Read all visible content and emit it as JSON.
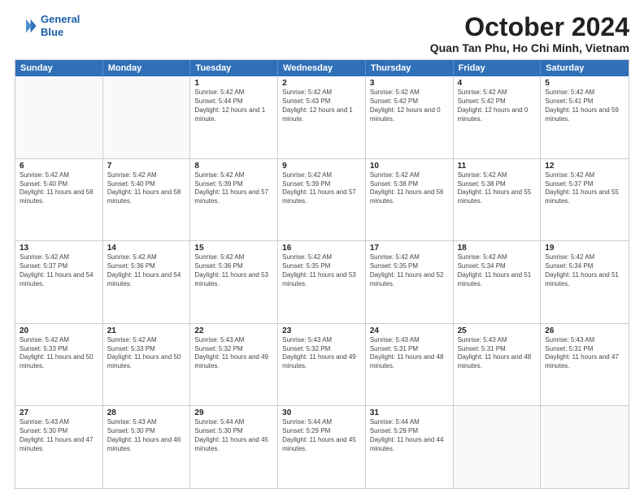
{
  "header": {
    "logo_line1": "General",
    "logo_line2": "Blue",
    "month_title": "October 2024",
    "subtitle": "Quan Tan Phu, Ho Chi Minh, Vietnam"
  },
  "days_of_week": [
    "Sunday",
    "Monday",
    "Tuesday",
    "Wednesday",
    "Thursday",
    "Friday",
    "Saturday"
  ],
  "weeks": [
    [
      {
        "day": "",
        "empty": true
      },
      {
        "day": "",
        "empty": true
      },
      {
        "day": "1",
        "sunrise": "5:42 AM",
        "sunset": "5:44 PM",
        "daylight": "12 hours and 1 minute."
      },
      {
        "day": "2",
        "sunrise": "5:42 AM",
        "sunset": "5:43 PM",
        "daylight": "12 hours and 1 minute."
      },
      {
        "day": "3",
        "sunrise": "5:42 AM",
        "sunset": "5:42 PM",
        "daylight": "12 hours and 0 minutes."
      },
      {
        "day": "4",
        "sunrise": "5:42 AM",
        "sunset": "5:42 PM",
        "daylight": "12 hours and 0 minutes."
      },
      {
        "day": "5",
        "sunrise": "5:42 AM",
        "sunset": "5:41 PM",
        "daylight": "11 hours and 59 minutes."
      }
    ],
    [
      {
        "day": "6",
        "sunrise": "5:42 AM",
        "sunset": "5:40 PM",
        "daylight": "11 hours and 58 minutes."
      },
      {
        "day": "7",
        "sunrise": "5:42 AM",
        "sunset": "5:40 PM",
        "daylight": "11 hours and 58 minutes."
      },
      {
        "day": "8",
        "sunrise": "5:42 AM",
        "sunset": "5:39 PM",
        "daylight": "11 hours and 57 minutes."
      },
      {
        "day": "9",
        "sunrise": "5:42 AM",
        "sunset": "5:39 PM",
        "daylight": "11 hours and 57 minutes."
      },
      {
        "day": "10",
        "sunrise": "5:42 AM",
        "sunset": "5:38 PM",
        "daylight": "11 hours and 56 minutes."
      },
      {
        "day": "11",
        "sunrise": "5:42 AM",
        "sunset": "5:38 PM",
        "daylight": "11 hours and 55 minutes."
      },
      {
        "day": "12",
        "sunrise": "5:42 AM",
        "sunset": "5:37 PM",
        "daylight": "11 hours and 55 minutes."
      }
    ],
    [
      {
        "day": "13",
        "sunrise": "5:42 AM",
        "sunset": "5:37 PM",
        "daylight": "11 hours and 54 minutes."
      },
      {
        "day": "14",
        "sunrise": "5:42 AM",
        "sunset": "5:36 PM",
        "daylight": "11 hours and 54 minutes."
      },
      {
        "day": "15",
        "sunrise": "5:42 AM",
        "sunset": "5:36 PM",
        "daylight": "11 hours and 53 minutes."
      },
      {
        "day": "16",
        "sunrise": "5:42 AM",
        "sunset": "5:35 PM",
        "daylight": "11 hours and 53 minutes."
      },
      {
        "day": "17",
        "sunrise": "5:42 AM",
        "sunset": "5:35 PM",
        "daylight": "11 hours and 52 minutes."
      },
      {
        "day": "18",
        "sunrise": "5:42 AM",
        "sunset": "5:34 PM",
        "daylight": "11 hours and 51 minutes."
      },
      {
        "day": "19",
        "sunrise": "5:42 AM",
        "sunset": "5:34 PM",
        "daylight": "11 hours and 51 minutes."
      }
    ],
    [
      {
        "day": "20",
        "sunrise": "5:42 AM",
        "sunset": "5:33 PM",
        "daylight": "11 hours and 50 minutes."
      },
      {
        "day": "21",
        "sunrise": "5:42 AM",
        "sunset": "5:33 PM",
        "daylight": "11 hours and 50 minutes."
      },
      {
        "day": "22",
        "sunrise": "5:43 AM",
        "sunset": "5:32 PM",
        "daylight": "11 hours and 49 minutes."
      },
      {
        "day": "23",
        "sunrise": "5:43 AM",
        "sunset": "5:32 PM",
        "daylight": "11 hours and 49 minutes."
      },
      {
        "day": "24",
        "sunrise": "5:43 AM",
        "sunset": "5:31 PM",
        "daylight": "11 hours and 48 minutes."
      },
      {
        "day": "25",
        "sunrise": "5:43 AM",
        "sunset": "5:31 PM",
        "daylight": "11 hours and 48 minutes."
      },
      {
        "day": "26",
        "sunrise": "5:43 AM",
        "sunset": "5:31 PM",
        "daylight": "11 hours and 47 minutes."
      }
    ],
    [
      {
        "day": "27",
        "sunrise": "5:43 AM",
        "sunset": "5:30 PM",
        "daylight": "11 hours and 47 minutes."
      },
      {
        "day": "28",
        "sunrise": "5:43 AM",
        "sunset": "5:30 PM",
        "daylight": "11 hours and 46 minutes."
      },
      {
        "day": "29",
        "sunrise": "5:44 AM",
        "sunset": "5:30 PM",
        "daylight": "11 hours and 45 minutes."
      },
      {
        "day": "30",
        "sunrise": "5:44 AM",
        "sunset": "5:29 PM",
        "daylight": "11 hours and 45 minutes."
      },
      {
        "day": "31",
        "sunrise": "5:44 AM",
        "sunset": "5:29 PM",
        "daylight": "11 hours and 44 minutes."
      },
      {
        "day": "",
        "empty": true
      },
      {
        "day": "",
        "empty": true
      }
    ]
  ]
}
